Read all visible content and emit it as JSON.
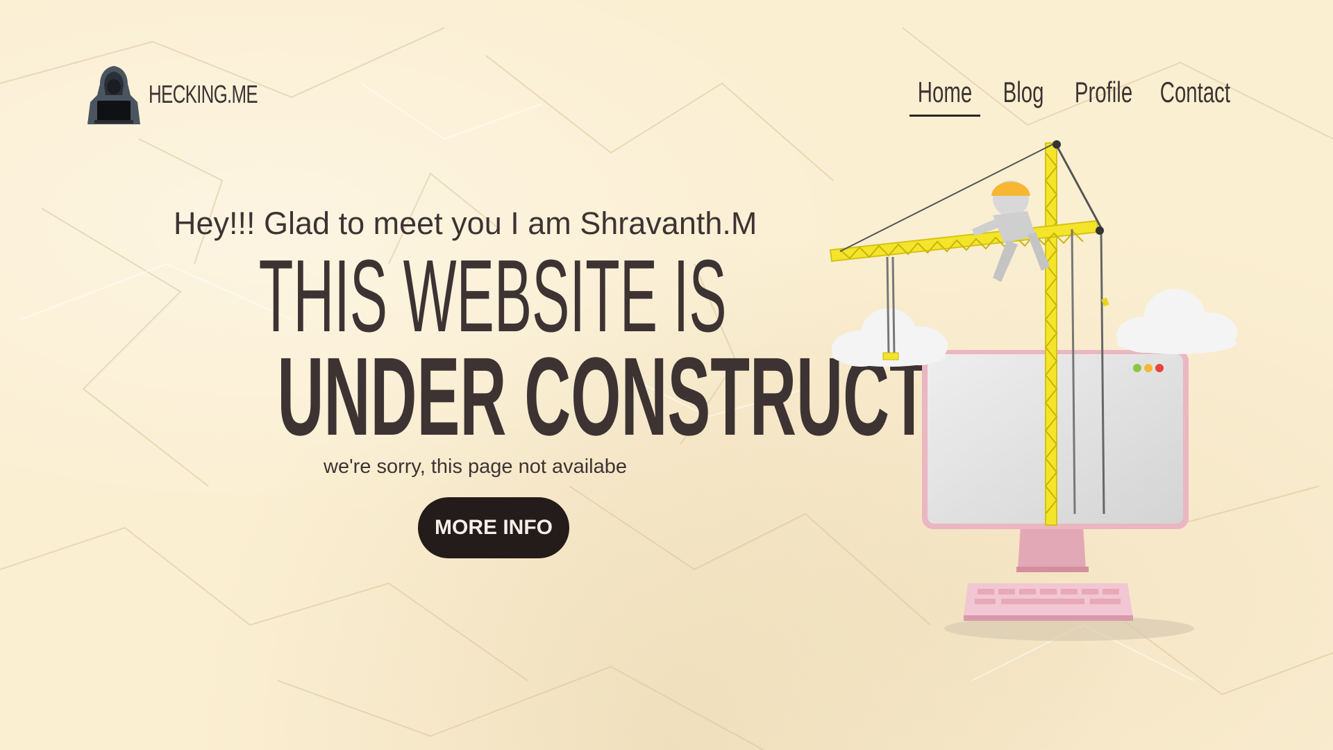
{
  "header": {
    "brand": "HECKING.ME",
    "nav": [
      {
        "label": "Home",
        "active": true
      },
      {
        "label": "Blog",
        "active": false
      },
      {
        "label": "Profile",
        "active": false
      },
      {
        "label": "Contact",
        "active": false
      }
    ]
  },
  "hero": {
    "greeting": "Hey!!! Glad to meet you I am Shravanth.M",
    "headline_line1": "THIS WEBSITE IS",
    "headline_line2": "UNDER CONSTRUCTION",
    "subtext": "we're sorry, this page not availabe",
    "cta_label": "MORE INFO"
  },
  "colors": {
    "background": "#fbefd2",
    "text": "#3d3333",
    "button": "#231c1a",
    "crane": "#f5e52a",
    "monitor_frame": "#e8b8c0"
  },
  "icons": {
    "logo": "hooded-hacker-laptop-icon",
    "illustration": "crane-building-monitor-illustration"
  }
}
